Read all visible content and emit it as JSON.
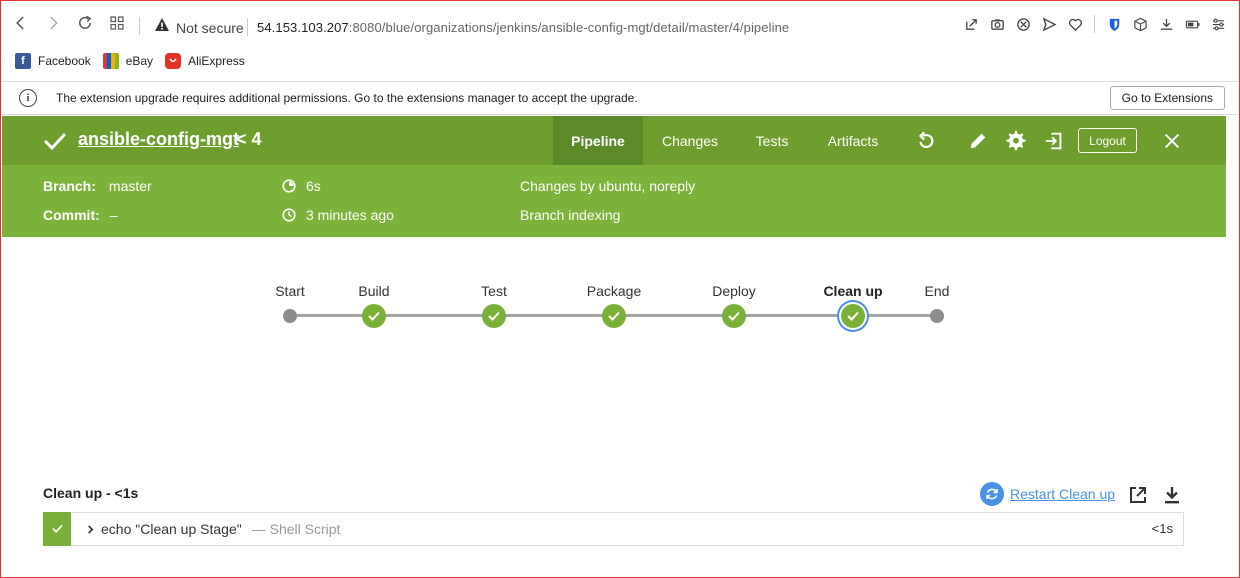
{
  "browser": {
    "security_label": "Not secure",
    "url_host": "54.153.103.207",
    "url_path": ":8080/blue/organizations/jenkins/ansible-config-mgt/detail/master/4/pipeline",
    "bookmarks": [
      {
        "label": "Facebook",
        "icon": "facebook-icon",
        "color": "#3b5998"
      },
      {
        "label": "eBay",
        "icon": "ebay-icon",
        "color": "#e53238"
      },
      {
        "label": "AliExpress",
        "icon": "aliexpress-icon",
        "color": "#e43225"
      }
    ],
    "infobar": {
      "message": "The extension upgrade requires additional permissions. Go to the extensions manager to accept the upgrade.",
      "button_label": "Go to Extensions"
    }
  },
  "jenkins": {
    "colors": {
      "header": "#6e9f2e",
      "header_active_tab": "#5b8a28",
      "meta": "#7bb23a",
      "success": "#78b037",
      "selected_ring": "#4a90e2"
    },
    "job_name": "ansible-config-mgt",
    "run_number": "< 4",
    "tabs": [
      {
        "label": "Pipeline",
        "active": true
      },
      {
        "label": "Changes",
        "active": false
      },
      {
        "label": "Tests",
        "active": false
      },
      {
        "label": "Artifacts",
        "active": false
      }
    ],
    "logout_label": "Logout",
    "meta": {
      "branch_label": "Branch:",
      "branch_value": "master",
      "commit_label": "Commit:",
      "commit_value": "–",
      "duration": "6s",
      "time_ago": "3 minutes ago",
      "changes": "Changes by ubuntu, noreply",
      "cause": "Branch indexing"
    }
  },
  "pipeline": {
    "stages": [
      {
        "label": "Start",
        "kind": "terminal"
      },
      {
        "label": "Build",
        "kind": "success"
      },
      {
        "label": "Test",
        "kind": "success"
      },
      {
        "label": "Package",
        "kind": "success"
      },
      {
        "label": "Deploy",
        "kind": "success"
      },
      {
        "label": "Clean up",
        "kind": "success",
        "selected": true
      },
      {
        "label": "End",
        "kind": "terminal"
      }
    ]
  },
  "log": {
    "stage_title": "Clean up - <1s",
    "restart_label": "Restart Clean up",
    "steps": [
      {
        "command": "echo \"Clean up Stage\"",
        "type": "— Shell Script",
        "duration": "<1s",
        "status": "success"
      }
    ]
  }
}
